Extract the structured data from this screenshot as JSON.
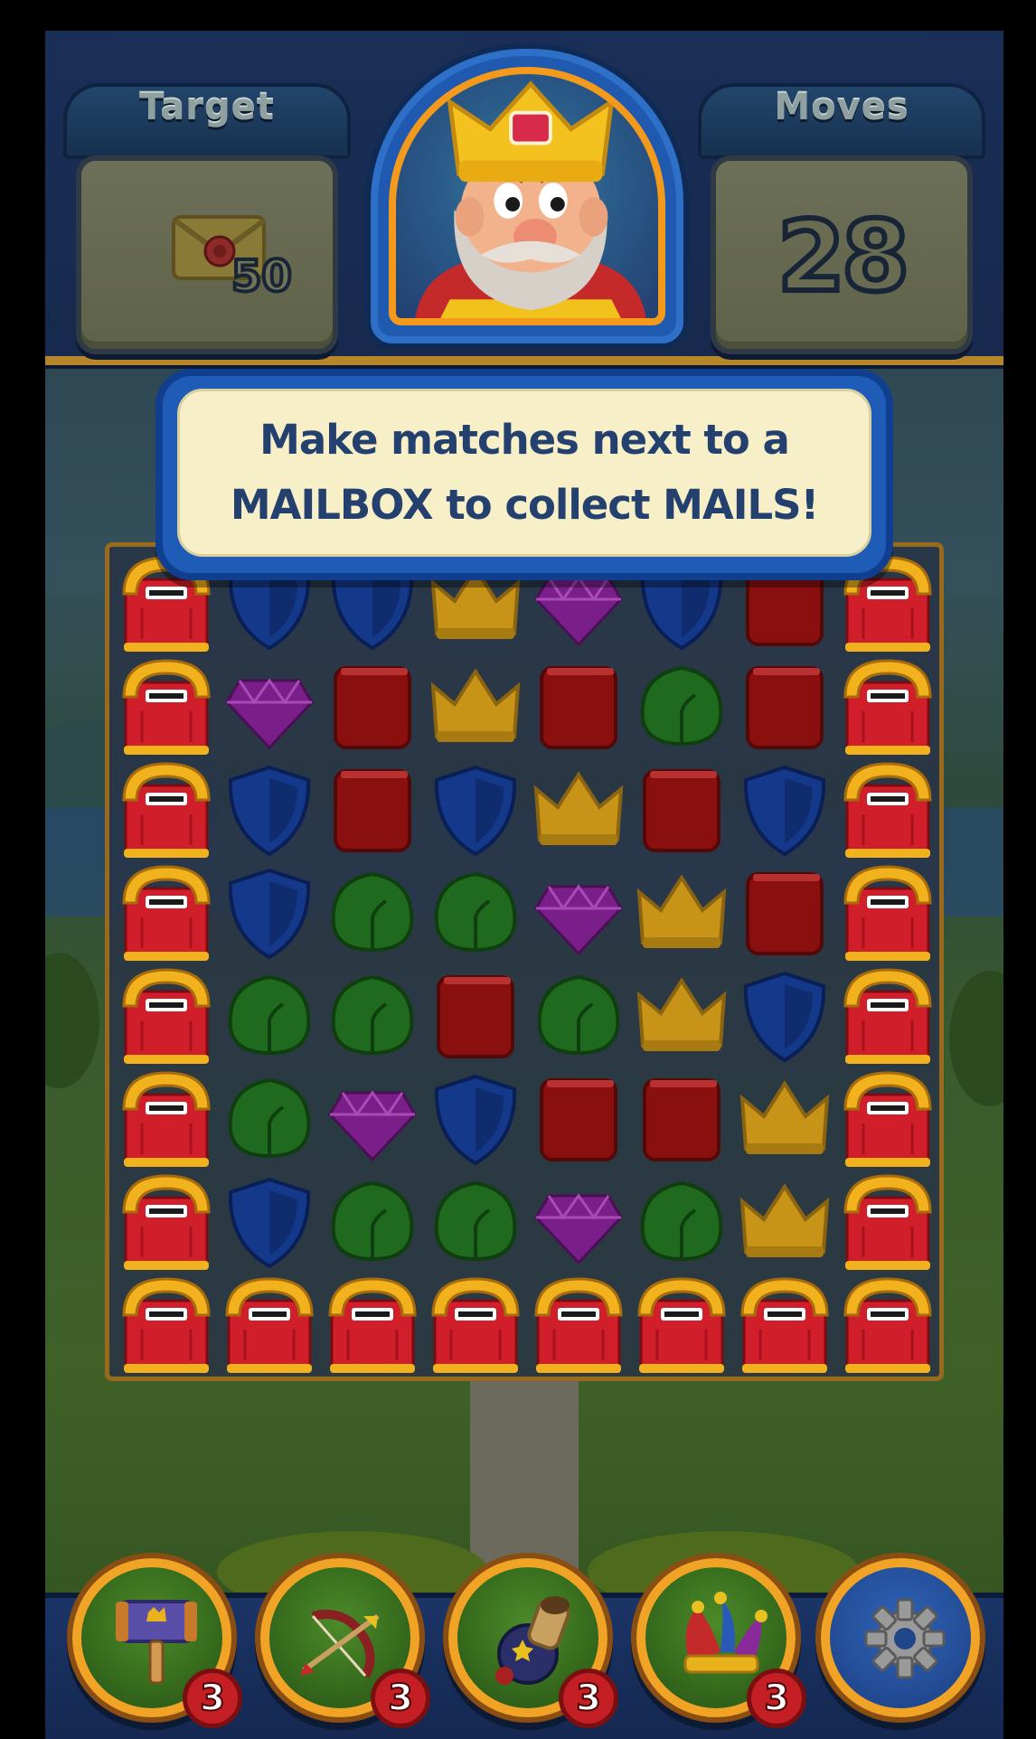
{
  "header": {
    "target_label": "Target",
    "target_count": "50",
    "target_item": "mail-icon",
    "moves_label": "Moves",
    "moves_value": "28"
  },
  "tutorial": {
    "line1": "Make matches next to a",
    "line2": "MAILBOX to collect MAILS!"
  },
  "board": {
    "columns": 8,
    "rows": 8,
    "legend": {
      "M": "mailbox",
      "B": "blue-shield",
      "P": "purple-gem",
      "R": "red-book",
      "Y": "yellow-crown",
      "G": "green-leaf"
    },
    "grid": [
      [
        "M",
        "B",
        "B",
        "Y",
        "P",
        "B",
        "R",
        "M"
      ],
      [
        "M",
        "P",
        "R",
        "Y",
        "R",
        "G",
        "R",
        "M"
      ],
      [
        "M",
        "B",
        "R",
        "B",
        "Y",
        "R",
        "B",
        "M"
      ],
      [
        "M",
        "B",
        "G",
        "G",
        "P",
        "Y",
        "R",
        "M"
      ],
      [
        "M",
        "G",
        "G",
        "R",
        "G",
        "Y",
        "B",
        "M"
      ],
      [
        "M",
        "G",
        "P",
        "B",
        "R",
        "R",
        "Y",
        "M"
      ],
      [
        "M",
        "B",
        "G",
        "G",
        "P",
        "G",
        "Y",
        "M"
      ],
      [
        "M",
        "M",
        "M",
        "M",
        "M",
        "M",
        "M",
        "M"
      ]
    ]
  },
  "boosters": [
    {
      "name": "hammer",
      "icon": "hammer-icon",
      "count": "3"
    },
    {
      "name": "arrow",
      "icon": "bow-arrow-icon",
      "count": "3"
    },
    {
      "name": "cannon",
      "icon": "cannon-icon",
      "count": "3"
    },
    {
      "name": "jester",
      "icon": "jester-hat-icon",
      "count": "3"
    }
  ],
  "settings": {
    "icon": "gear-icon"
  },
  "colors": {
    "header_bg": "#1a2f57",
    "tutorial_text": "#24406e",
    "board_border": "#9a6a1c",
    "badge": "#c41f24"
  }
}
